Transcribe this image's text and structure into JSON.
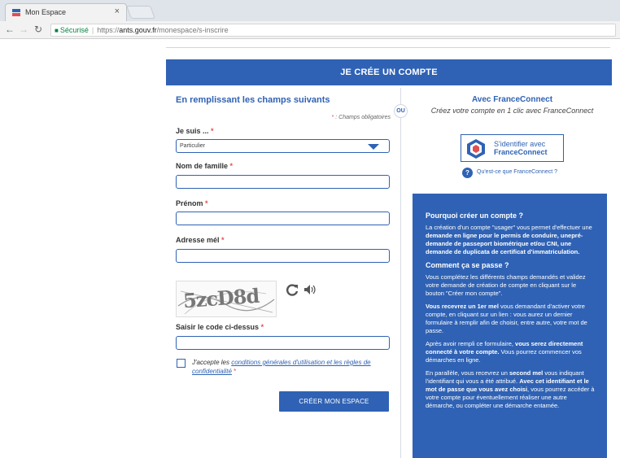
{
  "browser": {
    "tab_title": "Mon Espace",
    "tab_close": "×",
    "secure_label": "Sécurisé",
    "url_scheme": "https://",
    "url_host": "ants.gouv.fr",
    "url_path": "/monespace/s-inscrire"
  },
  "header": {
    "title": "JE CRÉE UN COMPTE"
  },
  "form": {
    "section_title": "En remplissant les champs suivants",
    "mandatory_note_star": "*",
    "mandatory_note": " : Champs obligatoires",
    "je_suis_label": "Je suis ...",
    "je_suis_value": "Particulier",
    "nom_label": "Nom de famille",
    "prenom_label": "Prénom",
    "email_label": "Adresse mél",
    "captcha_text": "5zcD8d",
    "captcha_label": "Saisir le code ci-dessus",
    "required_mark": "*",
    "terms_prefix": "J'accepte les ",
    "terms_link": "conditions générales d'utilisation et les règles de confidentialité",
    "submit_label": "CRÉER MON ESPACE"
  },
  "separator": {
    "or_label": "OU"
  },
  "franceconnect": {
    "title": "Avec FranceConnect",
    "subtitle": "Créez votre compte en 1 clic avec FranceConnect",
    "button_line1": "S'identifier avec",
    "button_line2": "FranceConnect",
    "help_icon_label": "?",
    "help_link": "Qu'est-ce que FranceConnect ?"
  },
  "info": {
    "heading1": "Pourquoi créer un compte ?",
    "p1_a": "La création d'un compte \"usager\" vous permet d'effectuer une ",
    "p1_b": "demande en ligne pour le permis de conduire, unepré-demande de passeport biométrique et/ou CNI, une demande de duplicata de certificat d'immatriculation.",
    "heading2": "Comment ça se passe ?",
    "p2": "Vous complétez les différents champs demandés et validez votre demande de création de compte en cliquant sur le bouton \"Créer mon compte\".",
    "p3_a": "Vous recevrez un 1er mel",
    "p3_b": " vous demandant d'activer votre compte, en cliquant sur un lien : vous aurez un dernier formulaire à remplir afin de choisir, entre autre, votre mot de passe.",
    "p4_a": "Après avoir rempli ce formulaire, ",
    "p4_b": "vous serez directement connecté à votre compte.",
    "p4_c": " Vous pourrez commencer vos démarches en ligne.",
    "p5_a": "En parallèle, vous recevrez un ",
    "p5_b": "second mel",
    "p5_c": " vous indiquant l'identifiant qui vous a été attribué. ",
    "p5_d": "Avec cet identifiant et le mot de passe que vous avez choisi",
    "p5_e": ", vous pourrez accéder à votre compte pour éventuellement réaliser une autre démarche, ou compléter une démarche entamée."
  },
  "colors": {
    "brand_blue": "#2f62b4",
    "required_red": "#e05050"
  },
  "icons": [
    "ants-favicon-icon",
    "back-arrow-icon",
    "forward-arrow-icon",
    "reload-icon",
    "lock-icon",
    "refresh-icon",
    "speaker-icon",
    "franceconnect-logo-icon",
    "help-icon",
    "chevron-down-icon"
  ]
}
